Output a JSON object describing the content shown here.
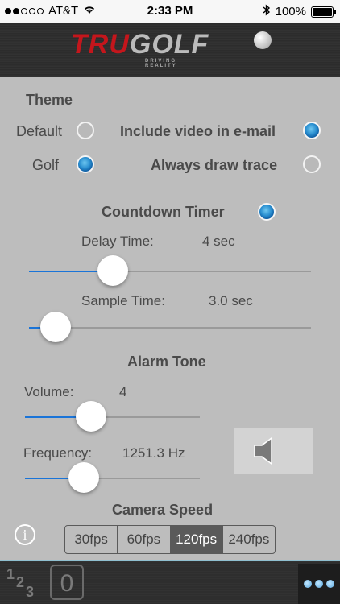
{
  "status": {
    "carrier": "AT&T",
    "time": "2:33 PM",
    "battery": "100%"
  },
  "header": {
    "logo_left": "TRU",
    "logo_right": "GOLF",
    "tagline": "DRIVING REALITY"
  },
  "theme": {
    "title": "Theme",
    "default_label": "Default",
    "golf_label": "Golf",
    "selected": "Golf"
  },
  "options": {
    "include_video_label": "Include video in e-mail",
    "include_video": true,
    "draw_trace_label": "Always draw trace",
    "draw_trace": false
  },
  "countdown": {
    "title": "Countdown Timer",
    "enabled": true,
    "delay_label": "Delay Time:",
    "delay_value": "4 sec",
    "delay_fraction": 0.3,
    "sample_label": "Sample Time:",
    "sample_value": "3.0 sec",
    "sample_fraction": 0.1
  },
  "alarm": {
    "title": "Alarm Tone",
    "volume_label": "Volume:",
    "volume_value": "4",
    "volume_fraction": 0.38,
    "frequency_label": "Frequency:",
    "frequency_value": "1251.3 Hz",
    "frequency_fraction": 0.32
  },
  "camera": {
    "title": "Camera Speed",
    "options": [
      "30fps",
      "60fps",
      "120fps",
      "240fps"
    ],
    "selected": "120fps"
  },
  "tabbar": {
    "tab1": "123",
    "tab2": "0"
  }
}
